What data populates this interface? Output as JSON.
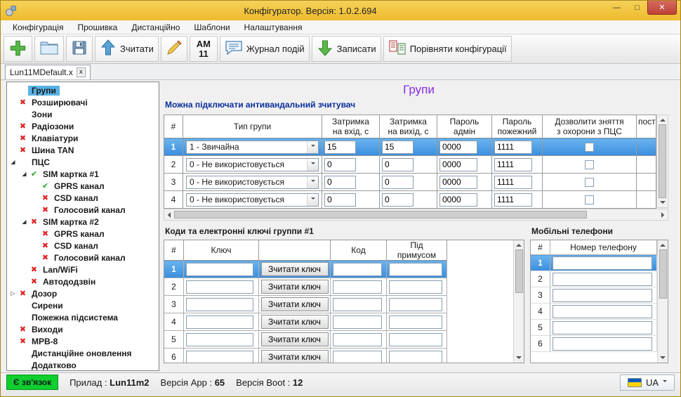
{
  "window": {
    "title": "Конфігуратор. Версія: 1.0.2.694",
    "minimize": "—",
    "maximize": "□",
    "close": "✕"
  },
  "menu": [
    "Конфігурація",
    "Прошивка",
    "Дистанційно",
    "Шаблони",
    "Налаштування"
  ],
  "toolbar": {
    "read": "Зчитати",
    "am_line1": "АМ",
    "am_line2": "11",
    "journal": "Журнал подій",
    "write": "Записати",
    "compare": "Порівняти конфігурації"
  },
  "tab": {
    "label": "Lun11MDefault.x",
    "close": "x"
  },
  "tree": [
    {
      "label": "Групи",
      "icon": "none",
      "level": 1,
      "selected": true
    },
    {
      "label": "Розширювачі",
      "icon": "red-x",
      "level": 1
    },
    {
      "label": "Зони",
      "icon": "none",
      "level": 1
    },
    {
      "label": "Радіозони",
      "icon": "red-x",
      "level": 1
    },
    {
      "label": "Клавіатури",
      "icon": "red-x",
      "level": 1
    },
    {
      "label": "Шина TAN",
      "icon": "red-x",
      "level": 1
    },
    {
      "label": "ПЦС",
      "icon": "none",
      "level": 1,
      "expander": "expanded"
    },
    {
      "label": "SIM картка #1",
      "icon": "green-check",
      "level": 2,
      "expander": "expanded"
    },
    {
      "label": "GPRS канал",
      "icon": "green-check",
      "level": 3
    },
    {
      "label": "CSD канал",
      "icon": "red-x",
      "level": 3
    },
    {
      "label": "Голосовий канал",
      "icon": "red-x",
      "level": 3
    },
    {
      "label": "SIM картка #2",
      "icon": "red-x",
      "level": 2,
      "expander": "expanded"
    },
    {
      "label": "GPRS канал",
      "icon": "red-x",
      "level": 3
    },
    {
      "label": "CSD канал",
      "icon": "red-x",
      "level": 3
    },
    {
      "label": "Голосовий канал",
      "icon": "red-x",
      "level": 3
    },
    {
      "label": "Lan/WiFi",
      "icon": "red-x",
      "level": 2
    },
    {
      "label": "Автододзвін",
      "icon": "red-x",
      "level": 2
    },
    {
      "label": "Дозор",
      "icon": "red-x",
      "level": 1,
      "expander": "collapsed"
    },
    {
      "label": "Сирени",
      "icon": "none",
      "level": 1
    },
    {
      "label": "Пожежна підсистема",
      "icon": "none",
      "level": 1
    },
    {
      "label": "Виходи",
      "icon": "red-x",
      "level": 1
    },
    {
      "label": "МРВ-8",
      "icon": "red-x",
      "level": 1
    },
    {
      "label": "Дистанційне оновлення",
      "icon": "none",
      "level": 1
    },
    {
      "label": "Додатково",
      "icon": "none",
      "level": 1
    }
  ],
  "main": {
    "title": "Групи",
    "note": "Можна підключати антивандальний зчитувач",
    "groups_table": {
      "headers": [
        "#",
        "Тип групи",
        "Затримка\nна вхід, с",
        "Затримка\nна вихід, с",
        "Пароль\nадмін",
        "Пароль\nпожежний",
        "Дозволити зняття\nз охорони з ПЦС",
        "пост"
      ],
      "rows": [
        {
          "num": "1",
          "type": "1 - Звичайна",
          "entry_delay": "15",
          "exit_delay": "15",
          "admin_pass": "0000",
          "fire_pass": "1111",
          "pcs_checked": false,
          "selected": true
        },
        {
          "num": "2",
          "type": "0 - Не використовується",
          "entry_delay": "0",
          "exit_delay": "0",
          "admin_pass": "0000",
          "fire_pass": "1111",
          "pcs_checked": false,
          "selected": false
        },
        {
          "num": "3",
          "type": "0 - Не використовується",
          "entry_delay": "0",
          "exit_delay": "0",
          "admin_pass": "0000",
          "fire_pass": "1111",
          "pcs_checked": false,
          "selected": false
        },
        {
          "num": "4",
          "type": "0 - Не використовується",
          "entry_delay": "0",
          "exit_delay": "0",
          "admin_pass": "0000",
          "fire_pass": "1111",
          "pcs_checked": false,
          "selected": false
        }
      ]
    },
    "keys_section": {
      "title": "Коди та електронні ключі группи #1",
      "headers": [
        "#",
        "Ключ",
        "",
        "Код",
        "Під\nпримусом"
      ],
      "read_key_button": "Зчитати ключ",
      "rows": [
        {
          "num": "1",
          "key": "",
          "code": "",
          "duress": "",
          "selected": true
        },
        {
          "num": "2",
          "key": "",
          "code": "",
          "duress": "",
          "selected": false
        },
        {
          "num": "3",
          "key": "",
          "code": "",
          "duress": "",
          "selected": false
        },
        {
          "num": "4",
          "key": "",
          "code": "",
          "duress": "",
          "selected": false
        },
        {
          "num": "5",
          "key": "",
          "code": "",
          "duress": "",
          "selected": false
        },
        {
          "num": "6",
          "key": "",
          "code": "",
          "duress": "",
          "selected": false
        }
      ]
    },
    "phones_section": {
      "title": "Мобільні телефони",
      "headers": [
        "#",
        "Номер телефону"
      ],
      "rows": [
        {
          "num": "1",
          "phone": "",
          "selected": true
        },
        {
          "num": "2",
          "phone": "",
          "selected": false
        },
        {
          "num": "3",
          "phone": "",
          "selected": false
        },
        {
          "num": "4",
          "phone": "",
          "selected": false
        },
        {
          "num": "5",
          "phone": "",
          "selected": false
        },
        {
          "num": "6",
          "phone": "",
          "selected": false
        }
      ]
    }
  },
  "statusbar": {
    "connection": "Є зв'язок",
    "device_label": "Прилад :",
    "device": "Lun11m2",
    "app_label": "Версія App :",
    "app": "65",
    "boot_label": "Версія Boot :",
    "boot": "12",
    "language": "UA"
  }
}
